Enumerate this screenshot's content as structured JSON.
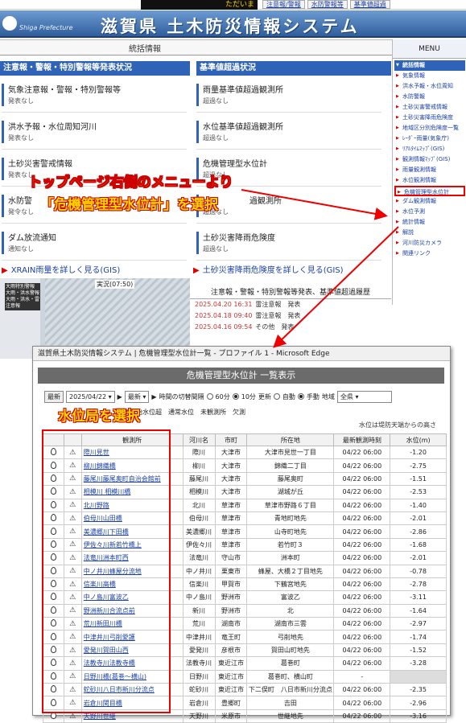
{
  "topbar": {
    "ticker": "ただいま",
    "links": [
      "注意報/警報",
      "水防警報等",
      "基準値超過"
    ]
  },
  "header": {
    "logo_text": "Shiga Prefecture",
    "title": "滋賀県 土木防災情報システム"
  },
  "nav": {
    "tab": "統括情報"
  },
  "panels": {
    "left_title": "注意報・警報・特別警報等発表状況",
    "right_title": "基準値超過状況",
    "left_items": [
      {
        "title": "気象注意報・警報・特別警報等",
        "status": "発表なし"
      },
      {
        "title": "洪水予報・水位周知河川",
        "status": "発表なし"
      },
      {
        "title": "土砂災害警戒情報",
        "status": "発表なし"
      },
      {
        "title": "水防警",
        "status": "発令なし"
      },
      {
        "title": "ダム放流通知",
        "status": "通知なし"
      }
    ],
    "right_items": [
      {
        "title": "雨量基準値超過観測所",
        "status": "超過なし"
      },
      {
        "title": "水位基準値超過観測所",
        "status": "超過なし"
      },
      {
        "title": "危機管理型水位計",
        "status": "超過なし"
      },
      {
        "title": "過観測所",
        "status": "超過なし"
      },
      {
        "title": "土砂災害降雨危険度",
        "status": "超過なし"
      }
    ],
    "left_link": "XRAIN雨量を詳しく見る(GIS)",
    "right_link": "土砂災害降雨危険度を詳しく見る(GIS)"
  },
  "menu": {
    "title": "MENU",
    "items": [
      "統括情報",
      "気象情報",
      "洪水予報・水位周知",
      "水防警報",
      "土砂災害警戒情報",
      "土砂災害降雨危険度",
      "地域区分別危険度一覧",
      "ﾚｰﾀﾞｰ雨量(気象庁)",
      "ﾘｱﾙﾀｲﾑﾏｯﾌﾟ(GIS)",
      "観測情報ﾏｯﾌﾟ(GIS)",
      "雨量観測情報",
      "水位観測情報",
      "危機管理型水位計",
      "ダム観測情報",
      "水位予測",
      "統計情報",
      "解説",
      "河川防災カメラ",
      "関連リンク"
    ],
    "highlight_index": 12
  },
  "map": {
    "label": "大雨特別警報 大雨・洪水警報 大雨・洪水・雷注意報",
    "label2": "実況(07:50)"
  },
  "history": {
    "title": "注意報・警報・特別警報等発表、基準値超過履歴",
    "rows": [
      {
        "time": "2025.04.20 16:31",
        "text": "雷注意報　発表"
      },
      {
        "time": "2025.04.18 09:40",
        "text": "雷注意報　発表"
      },
      {
        "time": "2025.04.16 09:54",
        "text": "その他　発表"
      }
    ]
  },
  "annotations": {
    "line1": "トップページ右側のメニューより",
    "line2": "「危機管理型水位計」を選択",
    "line3": "水位局を選択"
  },
  "edge": {
    "window_title": "滋賀県土木防災情報システム | 危機管理型水位計一覧 - プロファイル 1 - Microsoft Edge",
    "heading": "危機管理型水位計 一覧表示",
    "controls": {
      "latest_btn": "最新",
      "date": "2025/04/22",
      "latest2": "最新",
      "interval_label": "時間の切替間隔",
      "opt60": "60分",
      "opt10": "10分",
      "update_label": "更新",
      "auto": "自動",
      "manual": "手動",
      "region_label": "地域",
      "region_value": "全県"
    },
    "legend": "観測開始水位超　通常水位　未観測所　欠測",
    "note": "水位は堤防天端からの高さ",
    "columns": [
      "観測所",
      "河川名",
      "市町",
      "所在地",
      "最新観測時刻",
      "水位(m)"
    ],
    "rows": [
      [
        "際川見世",
        "際川",
        "大津市",
        "大津市見世一丁目",
        "04/22 06:00",
        "-1.20"
      ],
      [
        "柳川錦織橋",
        "柳川",
        "大津市",
        "錦織二丁目",
        "04/22 06:00",
        "-2.75"
      ],
      [
        "藤尾川藤尾奥町自治会館前",
        "藤尾川",
        "大津市",
        "藤尾奥町",
        "04/22 06:00",
        "-1.51"
      ],
      [
        "相模川 相模川橋",
        "相模川",
        "大津市",
        "湖城が丘",
        "04/22 06:00",
        "-2.53"
      ],
      [
        "北川野路",
        "北川",
        "草津市",
        "草津市野路６丁目",
        "04/22 06:00",
        "-1.40"
      ],
      [
        "伯母川山田橋",
        "伯母川",
        "草津市",
        "青地町地先",
        "04/22 06:00",
        "-2.01"
      ],
      [
        "美濃郷川下田橋",
        "美濃郷川",
        "草津市",
        "山寺町地先",
        "04/22 06:00",
        "-2.86"
      ],
      [
        "伊佐々川新若竹橋上",
        "伊佐々川",
        "草津市",
        "若竹町３",
        "04/22 06:00",
        "-1.68"
      ],
      [
        "法竜川洲本町西",
        "法竜川",
        "守山市",
        "洲本町",
        "04/22 06:00",
        "-2.01"
      ],
      [
        "中ノ井川蜂屋分流地",
        "中ノ井川",
        "栗東市",
        "蜂屋、大橋２丁目地先",
        "04/22 06:00",
        "-0.78"
      ],
      [
        "信楽川高橋",
        "信楽川",
        "甲賀市",
        "下鶴宮地先",
        "04/22 06:00",
        "-2.78"
      ],
      [
        "中ノ島川富波乙",
        "中ノ島川",
        "野洲市",
        "富波乙",
        "04/22 06:00",
        "-3.11"
      ],
      [
        "野洲新川合流点前",
        "新川",
        "野洲市",
        "北",
        "04/22 06:00",
        "-1.64"
      ],
      [
        "荒川新田川橋",
        "荒川",
        "湖南市",
        "湖南市三雲",
        "04/22 06:00",
        "-2.97"
      ],
      [
        "中津井川弓削愛護",
        "中津井川",
        "竜王町",
        "弓削地先",
        "04/22 06:00",
        "-1.74"
      ],
      [
        "愛発川賀田山西",
        "愛発川",
        "彦根市",
        "賀田山町地先",
        "04/22 06:00",
        "-1.52"
      ],
      [
        "法教寺川法教寺橋",
        "法教寺川",
        "東近江市",
        "葛巻町",
        "04/22 06:00",
        "-3.28"
      ],
      [
        "日野川橋(葛巻～横山)",
        "日野川",
        "東近江市",
        "葛巻町、横山町",
        "-",
        ""
      ],
      [
        "蛇砂川八日市新川分流点",
        "蛇砂川",
        "東近江市",
        "下二俣町　八日市新川分流点",
        "04/22 06:00",
        "-2.35"
      ],
      [
        "岩倉川関目橋",
        "岩倉川",
        "豊郷町",
        "吉田",
        "04/22 06:00",
        "-2.96"
      ],
      [
        "天野川世継",
        "天野川",
        "米原市",
        "世継地先",
        "04/22 06:00",
        "-3.16"
      ]
    ],
    "gray_row": 17
  },
  "colors": {
    "accent": "#2f63b7",
    "annotation": "#ffd400",
    "annotation_outline": "#cc0000",
    "highlight": "#e00000"
  }
}
